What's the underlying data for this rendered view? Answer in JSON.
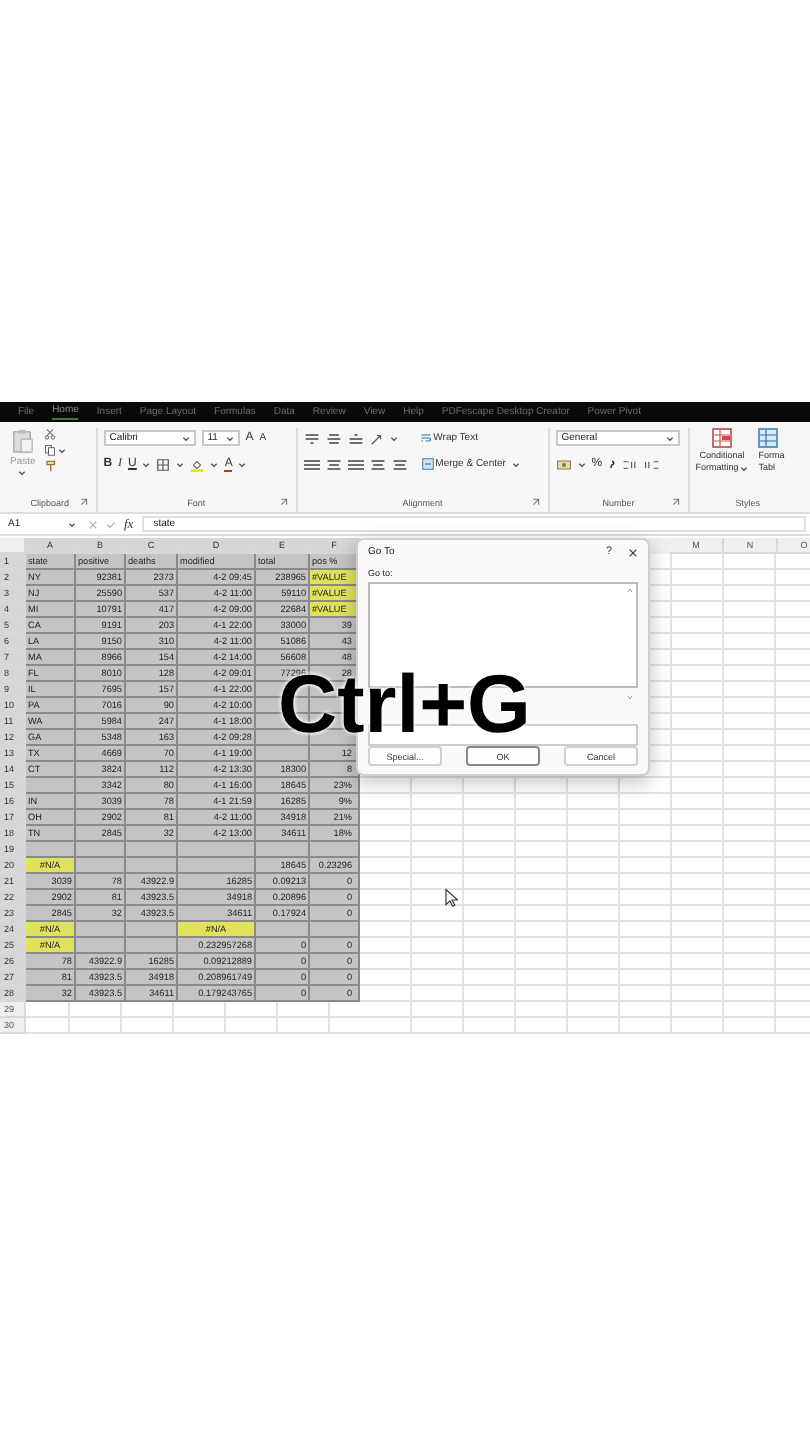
{
  "menu_tabs": [
    {
      "label": "File",
      "selected": false
    },
    {
      "label": "Home",
      "selected": true
    },
    {
      "label": "Insert",
      "selected": false
    },
    {
      "label": "Page Layout",
      "selected": false
    },
    {
      "label": "Formulas",
      "selected": false
    },
    {
      "label": "Data",
      "selected": false
    },
    {
      "label": "Review",
      "selected": false
    },
    {
      "label": "View",
      "selected": false
    },
    {
      "label": "Help",
      "selected": false
    },
    {
      "label": "PDFescape Desktop Creator",
      "selected": false
    },
    {
      "label": "Power Pivot",
      "selected": false
    }
  ],
  "ribbon": {
    "clipboard": {
      "paste": "Paste",
      "label": "Clipboard"
    },
    "font": {
      "name": "Calibri",
      "size": "11",
      "grow": "A",
      "shrink": "A",
      "bold": "B",
      "italic": "I",
      "underline": "U",
      "color_letter": "A",
      "label": "Font"
    },
    "alignment": {
      "wrap": "Wrap Text",
      "merge": "Merge & Center",
      "label": "Alignment"
    },
    "number": {
      "format": "General",
      "percent": "%",
      "label": "Number"
    },
    "styles": {
      "conditional": [
        "Conditional",
        "Formatting"
      ],
      "format_table": [
        "Forma",
        "Tabl"
      ],
      "label": "Styles"
    }
  },
  "formula_bar": {
    "name_box": "A1",
    "fx": "fx",
    "content": "state"
  },
  "columns": [
    "A",
    "B",
    "C",
    "D",
    "E",
    "F",
    "M",
    "N",
    "O"
  ],
  "rows": [
    {
      "number": "1",
      "selected": true,
      "cells": [
        {
          "text": "state",
          "kind": "text",
          "highlighted": false
        },
        {
          "text": "positive",
          "kind": "text",
          "highlighted": false
        },
        {
          "text": "deaths",
          "kind": "text",
          "highlighted": false
        },
        {
          "text": "modified",
          "kind": "text",
          "highlighted": false
        },
        {
          "text": "total",
          "kind": "text",
          "highlighted": false
        },
        {
          "text": "pos %",
          "kind": "text",
          "highlighted": false
        }
      ]
    },
    {
      "number": "2",
      "selected": true,
      "cells": [
        {
          "text": "NY",
          "kind": "text",
          "highlighted": false
        },
        {
          "text": "92381",
          "kind": "number",
          "highlighted": false
        },
        {
          "text": "2373",
          "kind": "number",
          "highlighted": false
        },
        {
          "text": "4-2 09:45",
          "kind": "number",
          "highlighted": false
        },
        {
          "text": "238965",
          "kind": "number",
          "highlighted": false
        },
        {
          "text": "#VALUE",
          "kind": "text",
          "highlighted": true
        }
      ]
    },
    {
      "number": "3",
      "selected": true,
      "cells": [
        {
          "text": "NJ",
          "kind": "text",
          "highlighted": false
        },
        {
          "text": "25590",
          "kind": "number",
          "highlighted": false
        },
        {
          "text": "537",
          "kind": "number",
          "highlighted": false
        },
        {
          "text": "4-2 11:00",
          "kind": "number",
          "highlighted": false
        },
        {
          "text": "59110",
          "kind": "number",
          "highlighted": false
        },
        {
          "text": "#VALUE",
          "kind": "text",
          "highlighted": true
        }
      ]
    },
    {
      "number": "4",
      "selected": true,
      "cells": [
        {
          "text": "MI",
          "kind": "text",
          "highlighted": false
        },
        {
          "text": "10791",
          "kind": "number",
          "highlighted": false
        },
        {
          "text": "417",
          "kind": "number",
          "highlighted": false
        },
        {
          "text": "4-2 09:00",
          "kind": "number",
          "highlighted": false
        },
        {
          "text": "22684",
          "kind": "number",
          "highlighted": false
        },
        {
          "text": "#VALUE",
          "kind": "text",
          "highlighted": true
        }
      ]
    },
    {
      "number": "5",
      "selected": true,
      "cells": [
        {
          "text": "CA",
          "kind": "text",
          "highlighted": false
        },
        {
          "text": "9191",
          "kind": "number",
          "highlighted": false
        },
        {
          "text": "203",
          "kind": "number",
          "highlighted": false
        },
        {
          "text": "4-1 22:00",
          "kind": "number",
          "highlighted": false
        },
        {
          "text": "33000",
          "kind": "number",
          "highlighted": false
        },
        {
          "text": "39",
          "kind": "number",
          "highlighted": false
        }
      ]
    },
    {
      "number": "6",
      "selected": true,
      "cells": [
        {
          "text": "LA",
          "kind": "text",
          "highlighted": false
        },
        {
          "text": "9150",
          "kind": "number",
          "highlighted": false
        },
        {
          "text": "310",
          "kind": "number",
          "highlighted": false
        },
        {
          "text": "4-2 11:00",
          "kind": "number",
          "highlighted": false
        },
        {
          "text": "51086",
          "kind": "number",
          "highlighted": false
        },
        {
          "text": "43",
          "kind": "number",
          "highlighted": false
        }
      ]
    },
    {
      "number": "7",
      "selected": true,
      "cells": [
        {
          "text": "MA",
          "kind": "text",
          "highlighted": false
        },
        {
          "text": "8966",
          "kind": "number",
          "highlighted": false
        },
        {
          "text": "154",
          "kind": "number",
          "highlighted": false
        },
        {
          "text": "4-2 14:00",
          "kind": "number",
          "highlighted": false
        },
        {
          "text": "56608",
          "kind": "number",
          "highlighted": false
        },
        {
          "text": "48",
          "kind": "number",
          "highlighted": false
        }
      ]
    },
    {
      "number": "8",
      "selected": true,
      "cells": [
        {
          "text": "FL",
          "kind": "text",
          "highlighted": false
        },
        {
          "text": "8010",
          "kind": "number",
          "highlighted": false
        },
        {
          "text": "128",
          "kind": "number",
          "highlighted": false
        },
        {
          "text": "4-2 09:01",
          "kind": "number",
          "highlighted": false
        },
        {
          "text": "77296",
          "kind": "number",
          "highlighted": false
        },
        {
          "text": "28",
          "kind": "number",
          "highlighted": false
        }
      ]
    },
    {
      "number": "9",
      "selected": true,
      "cells": [
        {
          "text": "IL",
          "kind": "text",
          "highlighted": false
        },
        {
          "text": "7695",
          "kind": "number",
          "highlighted": false
        },
        {
          "text": "157",
          "kind": "number",
          "highlighted": false
        },
        {
          "text": "4-1 22:00",
          "kind": "number",
          "highlighted": false
        },
        null,
        null
      ]
    },
    {
      "number": "10",
      "selected": true,
      "cells": [
        {
          "text": "PA",
          "kind": "text",
          "highlighted": false
        },
        {
          "text": "7016",
          "kind": "number",
          "highlighted": false
        },
        {
          "text": "90",
          "kind": "number",
          "highlighted": false
        },
        {
          "text": "4-2 10:00",
          "kind": "number",
          "highlighted": false
        },
        null,
        null
      ]
    },
    {
      "number": "11",
      "selected": true,
      "cells": [
        {
          "text": "WA",
          "kind": "text",
          "highlighted": false
        },
        {
          "text": "5984",
          "kind": "number",
          "highlighted": false
        },
        {
          "text": "247",
          "kind": "number",
          "highlighted": false
        },
        {
          "text": "4-1 18:00",
          "kind": "number",
          "highlighted": false
        },
        null,
        null
      ]
    },
    {
      "number": "12",
      "selected": true,
      "cells": [
        {
          "text": "GA",
          "kind": "text",
          "highlighted": false
        },
        {
          "text": "5348",
          "kind": "number",
          "highlighted": false
        },
        {
          "text": "163",
          "kind": "number",
          "highlighted": false
        },
        {
          "text": "4-2 09:28",
          "kind": "number",
          "highlighted": false
        },
        null,
        null
      ]
    },
    {
      "number": "13",
      "selected": true,
      "cells": [
        {
          "text": "TX",
          "kind": "text",
          "highlighted": false
        },
        {
          "text": "4669",
          "kind": "number",
          "highlighted": false
        },
        {
          "text": "70",
          "kind": "number",
          "highlighted": false
        },
        {
          "text": "4-1 19:00",
          "kind": "number",
          "highlighted": false
        },
        null,
        {
          "text": "12",
          "kind": "number",
          "highlighted": false
        }
      ]
    },
    {
      "number": "14",
      "selected": true,
      "cells": [
        {
          "text": "CT",
          "kind": "text",
          "highlighted": false
        },
        {
          "text": "3824",
          "kind": "number",
          "highlighted": false
        },
        {
          "text": "112",
          "kind": "number",
          "highlighted": false
        },
        {
          "text": "4-2 13:30",
          "kind": "number",
          "highlighted": false
        },
        {
          "text": "18300",
          "kind": "number",
          "highlighted": false
        },
        {
          "text": "8",
          "kind": "number",
          "highlighted": false
        }
      ]
    },
    {
      "number": "15",
      "selected": true,
      "cells": [
        null,
        {
          "text": "3342",
          "kind": "number",
          "highlighted": false
        },
        {
          "text": "80",
          "kind": "number",
          "highlighted": false
        },
        {
          "text": "4-1 16:00",
          "kind": "number",
          "highlighted": false
        },
        {
          "text": "18645",
          "kind": "number",
          "highlighted": false
        },
        {
          "text": "23%",
          "kind": "number",
          "highlighted": false
        }
      ]
    },
    {
      "number": "16",
      "selected": true,
      "cells": [
        {
          "text": "IN",
          "kind": "text",
          "highlighted": false
        },
        {
          "text": "3039",
          "kind": "number",
          "highlighted": false
        },
        {
          "text": "78",
          "kind": "number",
          "highlighted": false
        },
        {
          "text": "4-1 21:59",
          "kind": "number",
          "highlighted": false
        },
        {
          "text": "16285",
          "kind": "number",
          "highlighted": false
        },
        {
          "text": "9%",
          "kind": "number",
          "highlighted": false
        }
      ]
    },
    {
      "number": "17",
      "selected": true,
      "cells": [
        {
          "text": "OH",
          "kind": "text",
          "highlighted": false
        },
        {
          "text": "2902",
          "kind": "number",
          "highlighted": false
        },
        {
          "text": "81",
          "kind": "number",
          "highlighted": false
        },
        {
          "text": "4-2 11:00",
          "kind": "number",
          "highlighted": false
        },
        {
          "text": "34918",
          "kind": "number",
          "highlighted": false
        },
        {
          "text": "21%",
          "kind": "number",
          "highlighted": false
        }
      ]
    },
    {
      "number": "18",
      "selected": true,
      "cells": [
        {
          "text": "TN",
          "kind": "text",
          "highlighted": false
        },
        {
          "text": "2845",
          "kind": "number",
          "highlighted": false
        },
        {
          "text": "32",
          "kind": "number",
          "highlighted": false
        },
        {
          "text": "4-2 13:00",
          "kind": "number",
          "highlighted": false
        },
        {
          "text": "34611",
          "kind": "number",
          "highlighted": false
        },
        {
          "text": "18%",
          "kind": "number",
          "highlighted": false
        }
      ]
    },
    {
      "number": "19",
      "selected": true,
      "cells": [
        null,
        null,
        null,
        null,
        null,
        null
      ]
    },
    {
      "number": "20",
      "selected": true,
      "cells": [
        {
          "text": "#N/A",
          "kind": "error",
          "highlighted": true
        },
        null,
        null,
        null,
        {
          "text": "18645",
          "kind": "number",
          "highlighted": false
        },
        {
          "text": "0.23296",
          "kind": "number",
          "highlighted": false
        }
      ]
    },
    {
      "number": "21",
      "selected": true,
      "cells": [
        {
          "text": "3039",
          "kind": "number",
          "highlighted": false
        },
        {
          "text": "78",
          "kind": "number",
          "highlighted": false
        },
        {
          "text": "43922.9",
          "kind": "number",
          "highlighted": false
        },
        {
          "text": "16285",
          "kind": "number",
          "highlighted": false
        },
        {
          "text": "0.09213",
          "kind": "number",
          "highlighted": false
        },
        {
          "text": "0",
          "kind": "number",
          "highlighted": false
        }
      ]
    },
    {
      "number": "22",
      "selected": true,
      "cells": [
        {
          "text": "2902",
          "kind": "number",
          "highlighted": false
        },
        {
          "text": "81",
          "kind": "number",
          "highlighted": false
        },
        {
          "text": "43923.5",
          "kind": "number",
          "highlighted": false
        },
        {
          "text": "34918",
          "kind": "number",
          "highlighted": false
        },
        {
          "text": "0.20896",
          "kind": "number",
          "highlighted": false
        },
        {
          "text": "0",
          "kind": "number",
          "highlighted": false
        }
      ]
    },
    {
      "number": "23",
      "selected": true,
      "cells": [
        {
          "text": "2845",
          "kind": "number",
          "highlighted": false
        },
        {
          "text": "32",
          "kind": "number",
          "highlighted": false
        },
        {
          "text": "43923.5",
          "kind": "number",
          "highlighted": false
        },
        {
          "text": "34611",
          "kind": "number",
          "highlighted": false
        },
        {
          "text": "0.17924",
          "kind": "number",
          "highlighted": false
        },
        {
          "text": "0",
          "kind": "number",
          "highlighted": false
        }
      ]
    },
    {
      "number": "24",
      "selected": true,
      "cells": [
        {
          "text": "#N/A",
          "kind": "error",
          "highlighted": true
        },
        null,
        null,
        {
          "text": "#N/A",
          "kind": "error",
          "highlighted": true
        },
        null,
        null
      ]
    },
    {
      "number": "25",
      "selected": true,
      "cells": [
        {
          "text": "#N/A",
          "kind": "error",
          "highlighted": true
        },
        null,
        null,
        {
          "text": "0.232957268",
          "kind": "number",
          "highlighted": false
        },
        {
          "text": "0",
          "kind": "number",
          "highlighted": false
        },
        {
          "text": "0",
          "kind": "number",
          "highlighted": false
        }
      ]
    },
    {
      "number": "26",
      "selected": true,
      "cells": [
        {
          "text": "78",
          "kind": "number",
          "highlighted": false
        },
        {
          "text": "43922.9",
          "kind": "number",
          "highlighted": false
        },
        {
          "text": "16285",
          "kind": "number",
          "highlighted": false
        },
        {
          "text": "0.09212889",
          "kind": "number",
          "highlighted": false
        },
        {
          "text": "0",
          "kind": "number",
          "highlighted": false
        },
        {
          "text": "0",
          "kind": "number",
          "highlighted": false
        }
      ]
    },
    {
      "number": "27",
      "selected": true,
      "cells": [
        {
          "text": "81",
          "kind": "number",
          "highlighted": false
        },
        {
          "text": "43923.5",
          "kind": "number",
          "highlighted": false
        },
        {
          "text": "34918",
          "kind": "number",
          "highlighted": false
        },
        {
          "text": "0.208961749",
          "kind": "number",
          "highlighted": false
        },
        {
          "text": "0",
          "kind": "number",
          "highlighted": false
        },
        {
          "text": "0",
          "kind": "number",
          "highlighted": false
        }
      ]
    },
    {
      "number": "28",
      "selected": true,
      "cells": [
        {
          "text": "32",
          "kind": "number",
          "highlighted": false
        },
        {
          "text": "43923.5",
          "kind": "number",
          "highlighted": false
        },
        {
          "text": "34611",
          "kind": "number",
          "highlighted": false
        },
        {
          "text": "0.179243765",
          "kind": "number",
          "highlighted": false
        },
        {
          "text": "0",
          "kind": "number",
          "highlighted": false
        },
        {
          "text": "0",
          "kind": "number",
          "highlighted": false
        }
      ]
    },
    {
      "number": "29",
      "selected": false,
      "cells": [
        null,
        null,
        null,
        null,
        null,
        null
      ]
    },
    {
      "number": "30",
      "selected": false,
      "cells": [
        null,
        null,
        null,
        null,
        null,
        null
      ]
    }
  ],
  "dialog": {
    "title": "Go To",
    "help": "?",
    "list_label": "Go to:",
    "buttons": [
      "Special...",
      "OK",
      "Cancel"
    ]
  },
  "caption": "Ctrl+G"
}
